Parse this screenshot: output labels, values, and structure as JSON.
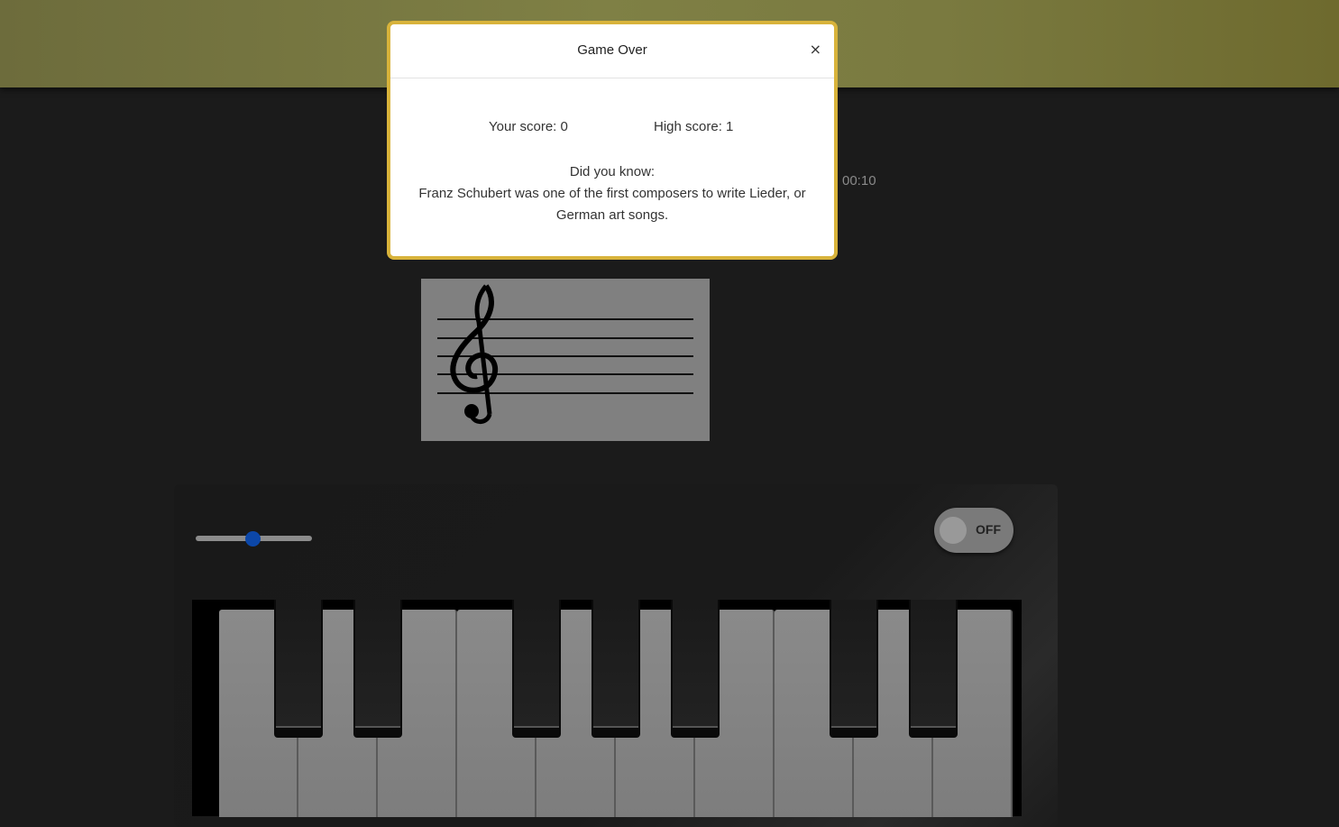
{
  "timer": "00:10",
  "modal": {
    "title": "Game Over",
    "close_label": "×",
    "your_score": "Your score: 0",
    "high_score": "High score: 1",
    "fact_heading": "Did you know:",
    "fact_text": "Franz Schubert was one of the first composers to write Lieder, or German art songs."
  },
  "staff": {
    "clef": "treble-clef-icon"
  },
  "controls": {
    "volume_level": 0.5,
    "power_label": "OFF",
    "power_state": false
  },
  "colors": {
    "banner": "#7f8045",
    "modal_border": "#d8b33b",
    "slider_thumb": "#0c47a8"
  }
}
